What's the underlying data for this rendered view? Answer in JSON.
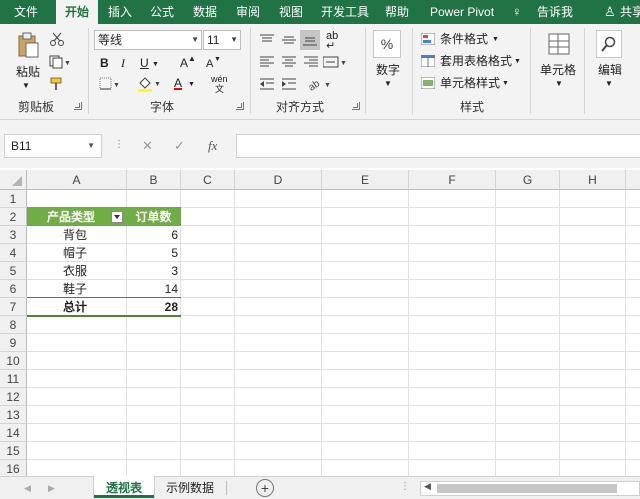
{
  "tabs": [
    "文件",
    "开始",
    "插入",
    "公式",
    "数据",
    "审阅",
    "视图",
    "开发工具",
    "帮助",
    "Power Pivot"
  ],
  "tell_me": "告诉我",
  "share": "共享",
  "ribbon": {
    "clipboard": {
      "paste": "粘贴",
      "label": "剪贴板"
    },
    "font": {
      "name": "等线",
      "size": "11",
      "bold": "B",
      "italic": "I",
      "underline": "U",
      "grow": "A",
      "shrink": "A",
      "fill_char": "A",
      "color_char": "A",
      "phonetic": "wén",
      "label": "字体"
    },
    "alignment": {
      "label": "对齐方式",
      "wrap": "ab"
    },
    "number": {
      "percent": "%",
      "label_btn": "数字"
    },
    "styles": {
      "conditional": "条件格式",
      "table": "套用表格格式",
      "cell": "单元格样式",
      "label": "样式"
    },
    "cells": {
      "label": "单元格"
    },
    "editing": {
      "label": "编辑"
    }
  },
  "formula_bar": {
    "name_box": "B11",
    "cancel": "✕",
    "enter": "✓",
    "fx": "fx",
    "value": ""
  },
  "columns": [
    "A",
    "B",
    "C",
    "D",
    "E",
    "F",
    "G",
    "H"
  ],
  "rows": [
    "1",
    "2",
    "3",
    "4",
    "5",
    "6",
    "7",
    "8",
    "9",
    "10",
    "11",
    "12",
    "13",
    "14",
    "15",
    "16"
  ],
  "pivot": {
    "header": [
      "产品类型",
      "订单数"
    ],
    "items": [
      {
        "label": "背包",
        "value": "6"
      },
      {
        "label": "帽子",
        "value": "5"
      },
      {
        "label": "衣服",
        "value": "3"
      },
      {
        "label": "鞋子",
        "value": "14"
      }
    ],
    "total": {
      "label": "总计",
      "value": "28"
    }
  },
  "sheets": [
    "透视表",
    "示例数据"
  ],
  "colors": {
    "accent": "#217346",
    "pivot_header": "#70ad47",
    "pivot_border": "#548235"
  }
}
